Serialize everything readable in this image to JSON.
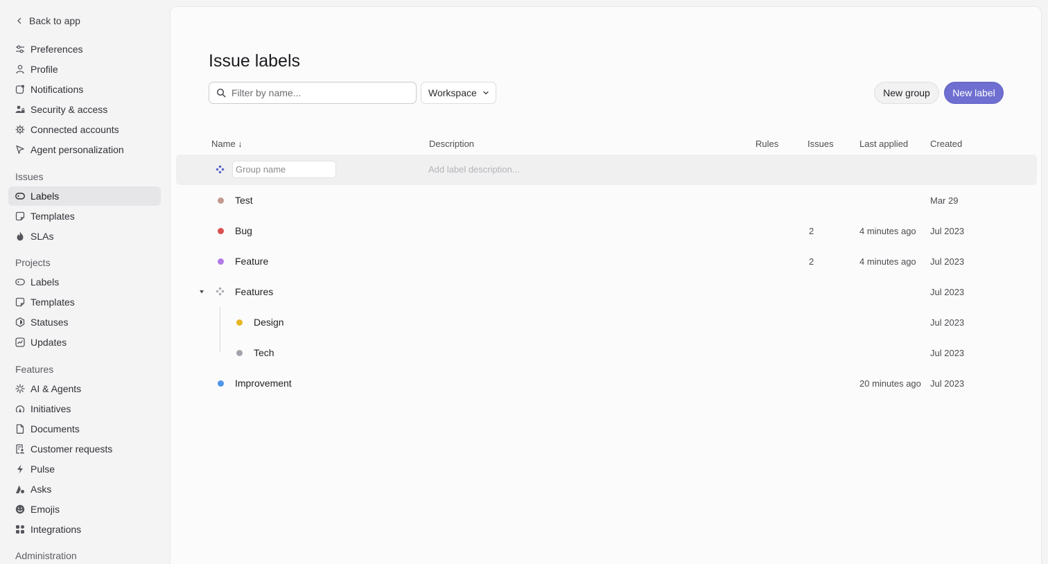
{
  "sidebar": {
    "back_label": "Back to app",
    "account_items": [
      {
        "label": "Preferences",
        "icon": "sliders-icon"
      },
      {
        "label": "Profile",
        "icon": "person-icon"
      },
      {
        "label": "Notifications",
        "icon": "notification-icon"
      },
      {
        "label": "Security & access",
        "icon": "users-lock-icon"
      },
      {
        "label": "Connected accounts",
        "icon": "gear-icon"
      },
      {
        "label": "Agent personalization",
        "icon": "agent-icon"
      }
    ],
    "sections": [
      {
        "title": "Issues",
        "items": [
          {
            "label": "Labels",
            "icon": "tag-icon",
            "active": true
          },
          {
            "label": "Templates",
            "icon": "template-icon"
          },
          {
            "label": "SLAs",
            "icon": "flame-icon"
          }
        ]
      },
      {
        "title": "Projects",
        "items": [
          {
            "label": "Labels",
            "icon": "tag-icon"
          },
          {
            "label": "Templates",
            "icon": "template-icon"
          },
          {
            "label": "Statuses",
            "icon": "hexagon-icon"
          },
          {
            "label": "Updates",
            "icon": "chart-icon"
          }
        ]
      },
      {
        "title": "Features",
        "items": [
          {
            "label": "AI & Agents",
            "icon": "sparkle-icon"
          },
          {
            "label": "Initiatives",
            "icon": "initiative-icon"
          },
          {
            "label": "Documents",
            "icon": "document-icon"
          },
          {
            "label": "Customer requests",
            "icon": "customer-request-icon"
          },
          {
            "label": "Pulse",
            "icon": "pulse-icon"
          },
          {
            "label": "Asks",
            "icon": "asks-icon"
          },
          {
            "label": "Emojis",
            "icon": "emoji-icon"
          },
          {
            "label": "Integrations",
            "icon": "integrations-icon"
          }
        ]
      },
      {
        "title": "Administration",
        "items": []
      }
    ]
  },
  "main": {
    "title": "Issue labels",
    "search_placeholder": "Filter by name...",
    "scope_label": "Workspace",
    "new_group_label": "New group",
    "new_label_label": "New label",
    "columns": {
      "name": "Name ↓",
      "description": "Description",
      "rules": "Rules",
      "issues": "Issues",
      "last_applied": "Last applied",
      "created": "Created"
    },
    "new_group_row": {
      "name_placeholder": "Group name",
      "description_placeholder": "Add label description..."
    },
    "rows": [
      {
        "name": "Test",
        "color": "#c29a8f",
        "issues": "",
        "last_applied": "",
        "created": "Mar 29",
        "level": 0,
        "type": "label"
      },
      {
        "name": "Bug",
        "color": "#d94f4f",
        "issues": "2",
        "last_applied": "4 minutes ago",
        "created": "Jul 2023",
        "level": 0,
        "type": "label"
      },
      {
        "name": "Feature",
        "color": "#b17ae8",
        "issues": "2",
        "last_applied": "4 minutes ago",
        "created": "Jul 2023",
        "level": 0,
        "type": "label"
      },
      {
        "name": "Features",
        "color": "#a9aaae",
        "issues": "",
        "last_applied": "",
        "created": "Jul 2023",
        "level": 0,
        "type": "group"
      },
      {
        "name": "Design",
        "color": "#e6b624",
        "issues": "",
        "last_applied": "",
        "created": "Jul 2023",
        "level": 1,
        "type": "label"
      },
      {
        "name": "Tech",
        "color": "#a2a3aa",
        "issues": "",
        "last_applied": "",
        "created": "Jul 2023",
        "level": 1,
        "type": "label"
      },
      {
        "name": "Improvement",
        "color": "#4e95e8",
        "issues": "",
        "last_applied": "20 minutes ago",
        "created": "Jul 2023",
        "level": 0,
        "type": "label"
      }
    ]
  },
  "colors": {
    "accent": "#6e6fd0",
    "sidebar_active_bg": "#e6e6e8",
    "group_icon_new": "#5b66c9"
  }
}
